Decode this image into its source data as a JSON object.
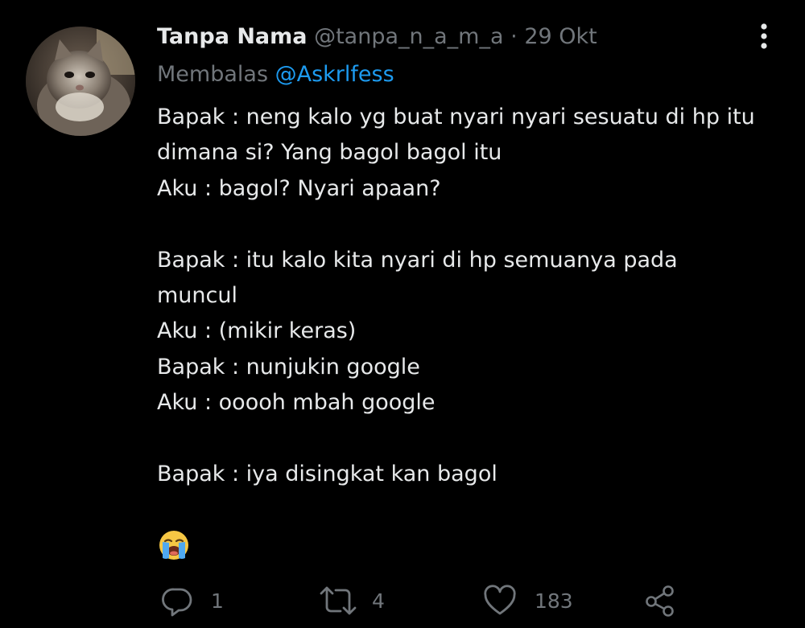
{
  "tweet": {
    "author": {
      "display_name": "Tanpa Nama",
      "handle": "@tanpa_n_a_m_a",
      "avatar": "cat-photo"
    },
    "separator": "·",
    "date": "29 Okt",
    "more_icon": "more-vertical-icon",
    "reply_label": "Membalas",
    "reply_to": "@Askrlfess",
    "body_lines": [
      "Bapak : neng kalo yg buat nyari nyari sesuatu di hp itu",
      "dimana si? Yang bagol bagol itu",
      "Aku : bagol? Nyari apaan?",
      "",
      "Bapak : itu kalo kita nyari di hp semuanya pada",
      "muncul",
      "Aku : (mikir keras)",
      "Bapak : nunjukin google",
      "Aku : ooooh mbah google",
      "",
      "Bapak : iya disingkat kan bagol"
    ],
    "emoji": "loudly-crying-face"
  },
  "actions": {
    "reply": {
      "icon": "reply-icon",
      "count": "1"
    },
    "retweet": {
      "icon": "retweet-icon",
      "count": "4"
    },
    "like": {
      "icon": "heart-icon",
      "count": "183"
    },
    "share": {
      "icon": "share-icon"
    }
  },
  "colors": {
    "background": "#000000",
    "text": "#e7e9ea",
    "muted": "#71767b",
    "accent": "#1d9bf0"
  }
}
